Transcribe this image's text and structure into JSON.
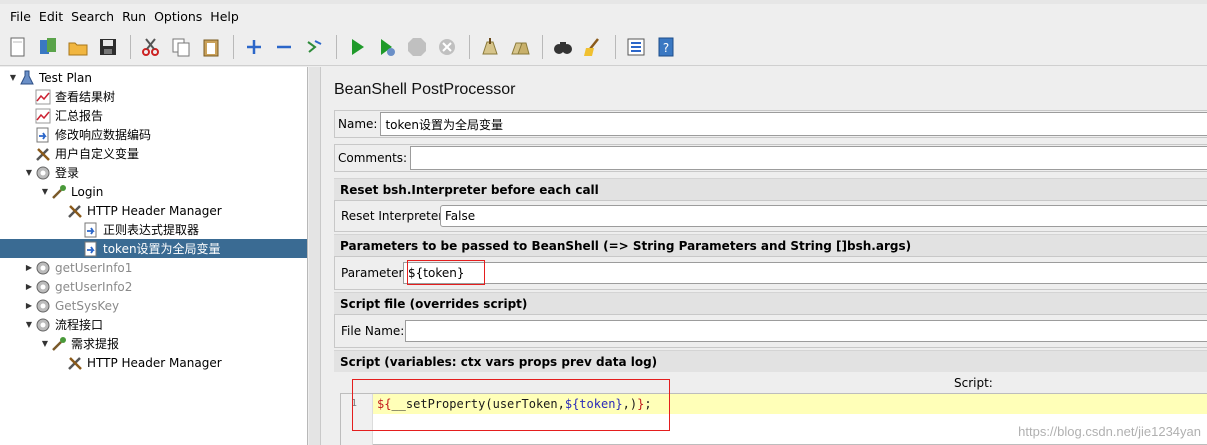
{
  "menubar": {
    "items": [
      "File",
      "Edit",
      "Search",
      "Run",
      "Options",
      "Help"
    ]
  },
  "toolbar": {
    "buttons": [
      "new-icon",
      "templates-icon",
      "open-icon",
      "save-icon",
      "cut-icon",
      "copy-icon",
      "paste-icon",
      "expand-icon",
      "collapse-icon",
      "toggle-icon",
      "start-icon",
      "start-no-pauses-icon",
      "stop-icon",
      "shutdown-icon",
      "clear-icon",
      "clear-all-icon",
      "search-icon",
      "reset-search-icon",
      "function-helper-icon",
      "help-icon"
    ]
  },
  "tree": {
    "items": [
      {
        "label": "Test Plan",
        "icon": "test-plan-icon",
        "twisty": "▼",
        "disabled": false,
        "selected": false
      },
      {
        "label": "查看结果树",
        "icon": "listener-icon",
        "twisty": "",
        "disabled": false,
        "selected": false
      },
      {
        "label": "汇总报告",
        "icon": "listener-icon",
        "twisty": "",
        "disabled": false,
        "selected": false
      },
      {
        "label": "修改响应数据编码",
        "icon": "processor-icon",
        "twisty": "",
        "disabled": false,
        "selected": false
      },
      {
        "label": "用户自定义变量",
        "icon": "config-icon",
        "twisty": "",
        "disabled": false,
        "selected": false
      },
      {
        "label": "登录",
        "icon": "thread-group-icon",
        "twisty": "▼",
        "disabled": false,
        "selected": false
      },
      {
        "label": "Login",
        "icon": "sampler-icon",
        "twisty": "▼",
        "disabled": false,
        "selected": false
      },
      {
        "label": "HTTP Header Manager",
        "icon": "config-icon",
        "twisty": "",
        "disabled": false,
        "selected": false
      },
      {
        "label": "正则表达式提取器",
        "icon": "processor-icon",
        "twisty": "",
        "disabled": false,
        "selected": false
      },
      {
        "label": "token设置为全局变量",
        "icon": "processor-icon",
        "twisty": "",
        "disabled": false,
        "selected": true
      },
      {
        "label": "getUserInfo1",
        "icon": "thread-group-icon",
        "twisty": "▶",
        "disabled": true,
        "selected": false
      },
      {
        "label": "getUserInfo2",
        "icon": "thread-group-icon",
        "twisty": "▶",
        "disabled": true,
        "selected": false
      },
      {
        "label": "GetSysKey",
        "icon": "thread-group-icon",
        "twisty": "▶",
        "disabled": true,
        "selected": false
      },
      {
        "label": "流程接口",
        "icon": "thread-group-icon",
        "twisty": "▼",
        "disabled": false,
        "selected": false
      },
      {
        "label": "需求提报",
        "icon": "sampler-icon",
        "twisty": "▼",
        "disabled": false,
        "selected": false
      },
      {
        "label": "HTTP Header Manager",
        "icon": "config-icon",
        "twisty": "",
        "disabled": false,
        "selected": false
      }
    ]
  },
  "panel": {
    "title": "BeanShell PostProcessor",
    "name_label": "Name:",
    "name_value": "token设置为全局变量",
    "comments_label": "Comments:",
    "comments_value": "",
    "reset_section": "Reset bsh.Interpreter before each call",
    "reset_label": "Reset Interpreter:",
    "reset_value": "False",
    "params_section": "Parameters to be passed to BeanShell (=> String Parameters and String []bsh.args)",
    "params_label": "Parameters",
    "params_value": "${token}",
    "file_section": "Script file (overrides script)",
    "file_label": "File Name:",
    "file_value": "",
    "script_section": "Script (variables: ctx vars props prev data log)",
    "script_label": "Script:",
    "line_number": "1",
    "code": {
      "p1": "${",
      "p2": "__setProperty(userToken,",
      "p3": "${token}",
      "p4": ",)",
      "p5": "}",
      "p6": ";"
    }
  },
  "watermark": "https://blog.csdn.net/jie1234yan"
}
